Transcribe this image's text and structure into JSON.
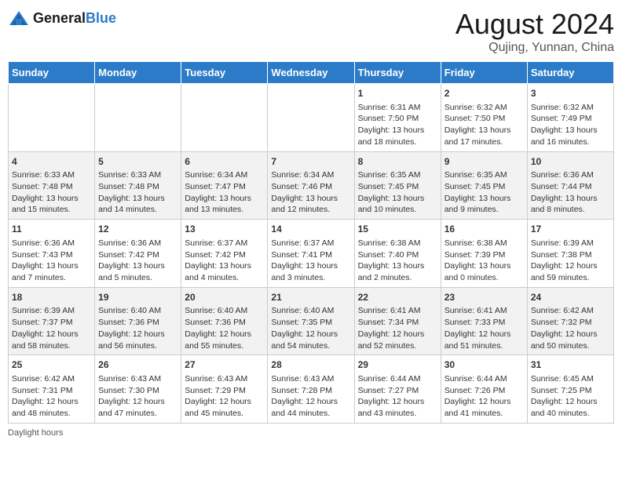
{
  "header": {
    "logo_general": "General",
    "logo_blue": "Blue",
    "month_title": "August 2024",
    "location": "Qujing, Yunnan, China"
  },
  "days_of_week": [
    "Sunday",
    "Monday",
    "Tuesday",
    "Wednesday",
    "Thursday",
    "Friday",
    "Saturday"
  ],
  "weeks": [
    [
      {
        "day": "",
        "info": ""
      },
      {
        "day": "",
        "info": ""
      },
      {
        "day": "",
        "info": ""
      },
      {
        "day": "",
        "info": ""
      },
      {
        "day": "1",
        "info": "Sunrise: 6:31 AM\nSunset: 7:50 PM\nDaylight: 13 hours and 18 minutes."
      },
      {
        "day": "2",
        "info": "Sunrise: 6:32 AM\nSunset: 7:50 PM\nDaylight: 13 hours and 17 minutes."
      },
      {
        "day": "3",
        "info": "Sunrise: 6:32 AM\nSunset: 7:49 PM\nDaylight: 13 hours and 16 minutes."
      }
    ],
    [
      {
        "day": "4",
        "info": "Sunrise: 6:33 AM\nSunset: 7:48 PM\nDaylight: 13 hours and 15 minutes."
      },
      {
        "day": "5",
        "info": "Sunrise: 6:33 AM\nSunset: 7:48 PM\nDaylight: 13 hours and 14 minutes."
      },
      {
        "day": "6",
        "info": "Sunrise: 6:34 AM\nSunset: 7:47 PM\nDaylight: 13 hours and 13 minutes."
      },
      {
        "day": "7",
        "info": "Sunrise: 6:34 AM\nSunset: 7:46 PM\nDaylight: 13 hours and 12 minutes."
      },
      {
        "day": "8",
        "info": "Sunrise: 6:35 AM\nSunset: 7:45 PM\nDaylight: 13 hours and 10 minutes."
      },
      {
        "day": "9",
        "info": "Sunrise: 6:35 AM\nSunset: 7:45 PM\nDaylight: 13 hours and 9 minutes."
      },
      {
        "day": "10",
        "info": "Sunrise: 6:36 AM\nSunset: 7:44 PM\nDaylight: 13 hours and 8 minutes."
      }
    ],
    [
      {
        "day": "11",
        "info": "Sunrise: 6:36 AM\nSunset: 7:43 PM\nDaylight: 13 hours and 7 minutes."
      },
      {
        "day": "12",
        "info": "Sunrise: 6:36 AM\nSunset: 7:42 PM\nDaylight: 13 hours and 5 minutes."
      },
      {
        "day": "13",
        "info": "Sunrise: 6:37 AM\nSunset: 7:42 PM\nDaylight: 13 hours and 4 minutes."
      },
      {
        "day": "14",
        "info": "Sunrise: 6:37 AM\nSunset: 7:41 PM\nDaylight: 13 hours and 3 minutes."
      },
      {
        "day": "15",
        "info": "Sunrise: 6:38 AM\nSunset: 7:40 PM\nDaylight: 13 hours and 2 minutes."
      },
      {
        "day": "16",
        "info": "Sunrise: 6:38 AM\nSunset: 7:39 PM\nDaylight: 13 hours and 0 minutes."
      },
      {
        "day": "17",
        "info": "Sunrise: 6:39 AM\nSunset: 7:38 PM\nDaylight: 12 hours and 59 minutes."
      }
    ],
    [
      {
        "day": "18",
        "info": "Sunrise: 6:39 AM\nSunset: 7:37 PM\nDaylight: 12 hours and 58 minutes."
      },
      {
        "day": "19",
        "info": "Sunrise: 6:40 AM\nSunset: 7:36 PM\nDaylight: 12 hours and 56 minutes."
      },
      {
        "day": "20",
        "info": "Sunrise: 6:40 AM\nSunset: 7:36 PM\nDaylight: 12 hours and 55 minutes."
      },
      {
        "day": "21",
        "info": "Sunrise: 6:40 AM\nSunset: 7:35 PM\nDaylight: 12 hours and 54 minutes."
      },
      {
        "day": "22",
        "info": "Sunrise: 6:41 AM\nSunset: 7:34 PM\nDaylight: 12 hours and 52 minutes."
      },
      {
        "day": "23",
        "info": "Sunrise: 6:41 AM\nSunset: 7:33 PM\nDaylight: 12 hours and 51 minutes."
      },
      {
        "day": "24",
        "info": "Sunrise: 6:42 AM\nSunset: 7:32 PM\nDaylight: 12 hours and 50 minutes."
      }
    ],
    [
      {
        "day": "25",
        "info": "Sunrise: 6:42 AM\nSunset: 7:31 PM\nDaylight: 12 hours and 48 minutes."
      },
      {
        "day": "26",
        "info": "Sunrise: 6:43 AM\nSunset: 7:30 PM\nDaylight: 12 hours and 47 minutes."
      },
      {
        "day": "27",
        "info": "Sunrise: 6:43 AM\nSunset: 7:29 PM\nDaylight: 12 hours and 45 minutes."
      },
      {
        "day": "28",
        "info": "Sunrise: 6:43 AM\nSunset: 7:28 PM\nDaylight: 12 hours and 44 minutes."
      },
      {
        "day": "29",
        "info": "Sunrise: 6:44 AM\nSunset: 7:27 PM\nDaylight: 12 hours and 43 minutes."
      },
      {
        "day": "30",
        "info": "Sunrise: 6:44 AM\nSunset: 7:26 PM\nDaylight: 12 hours and 41 minutes."
      },
      {
        "day": "31",
        "info": "Sunrise: 6:45 AM\nSunset: 7:25 PM\nDaylight: 12 hours and 40 minutes."
      }
    ]
  ],
  "footer": {
    "daylight_label": "Daylight hours"
  }
}
